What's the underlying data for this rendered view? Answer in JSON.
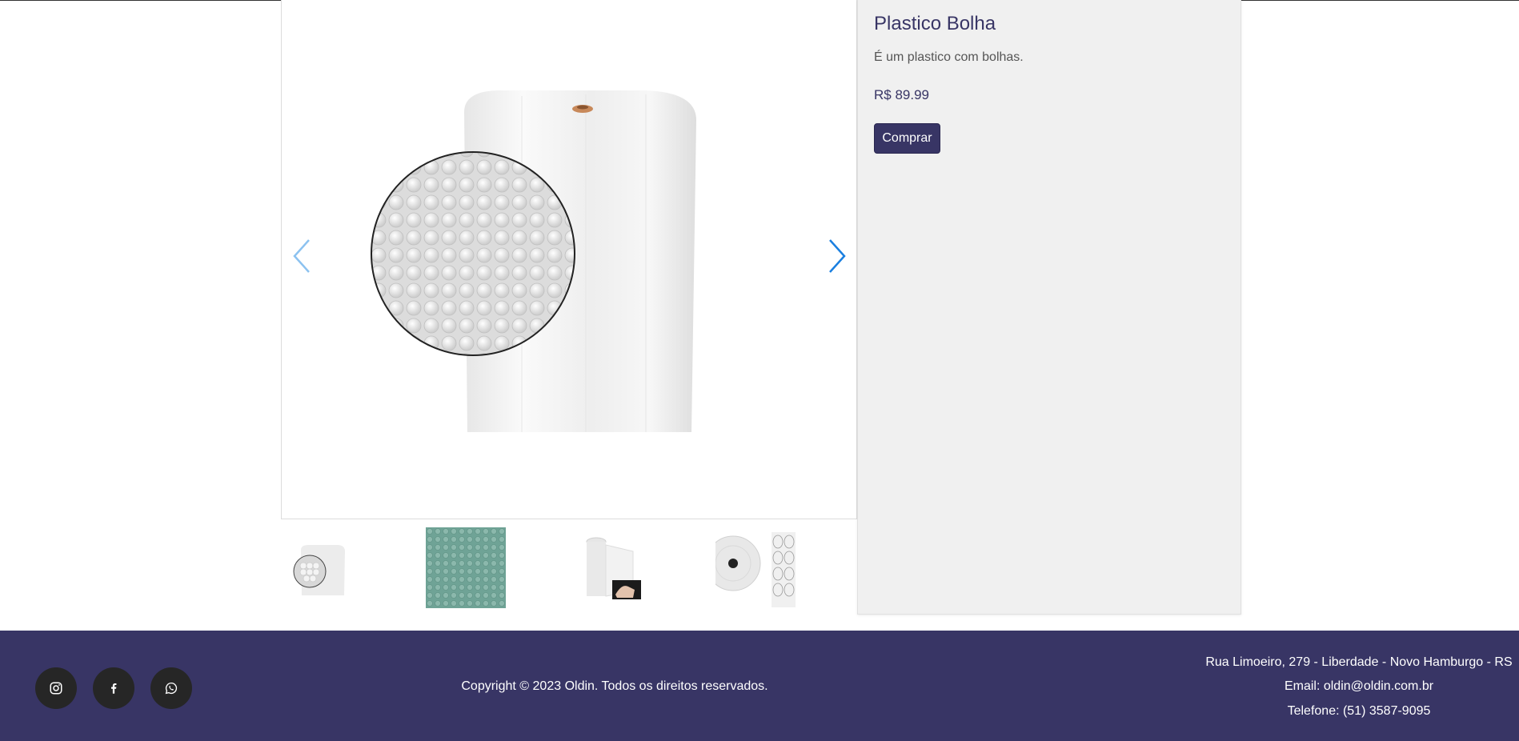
{
  "product": {
    "title": "Plastico Bolha",
    "description": "É um plastico com bolhas.",
    "price": "R$ 89.99",
    "buy_label": "Comprar"
  },
  "gallery": {
    "active_index": 0,
    "thumbnails": [
      {
        "name": "thumbnail-roll-magnifier"
      },
      {
        "name": "thumbnail-green-bubble-texture"
      },
      {
        "name": "thumbnail-roll-with-hand"
      },
      {
        "name": "thumbnail-roll-end-view"
      }
    ],
    "prev_icon": "chevron-left-icon",
    "next_icon": "chevron-right-icon"
  },
  "footer": {
    "social": [
      {
        "name": "instagram-icon"
      },
      {
        "name": "facebook-icon"
      },
      {
        "name": "whatsapp-icon"
      }
    ],
    "copyright": "Copyright © 2023 Oldin. Todos os direitos reservados.",
    "address": "Rua Limoeiro, 279 - Liberdade - Novo Hamburgo - RS",
    "email": "Email: oldin@oldin.com.br",
    "phone": "Telefone: (51) 3587-9095"
  },
  "colors": {
    "brand": "#383565",
    "panel_bg": "#f0f0f0",
    "arrow_active": "#1a7fe0",
    "arrow_inactive": "#8cc2f0"
  }
}
